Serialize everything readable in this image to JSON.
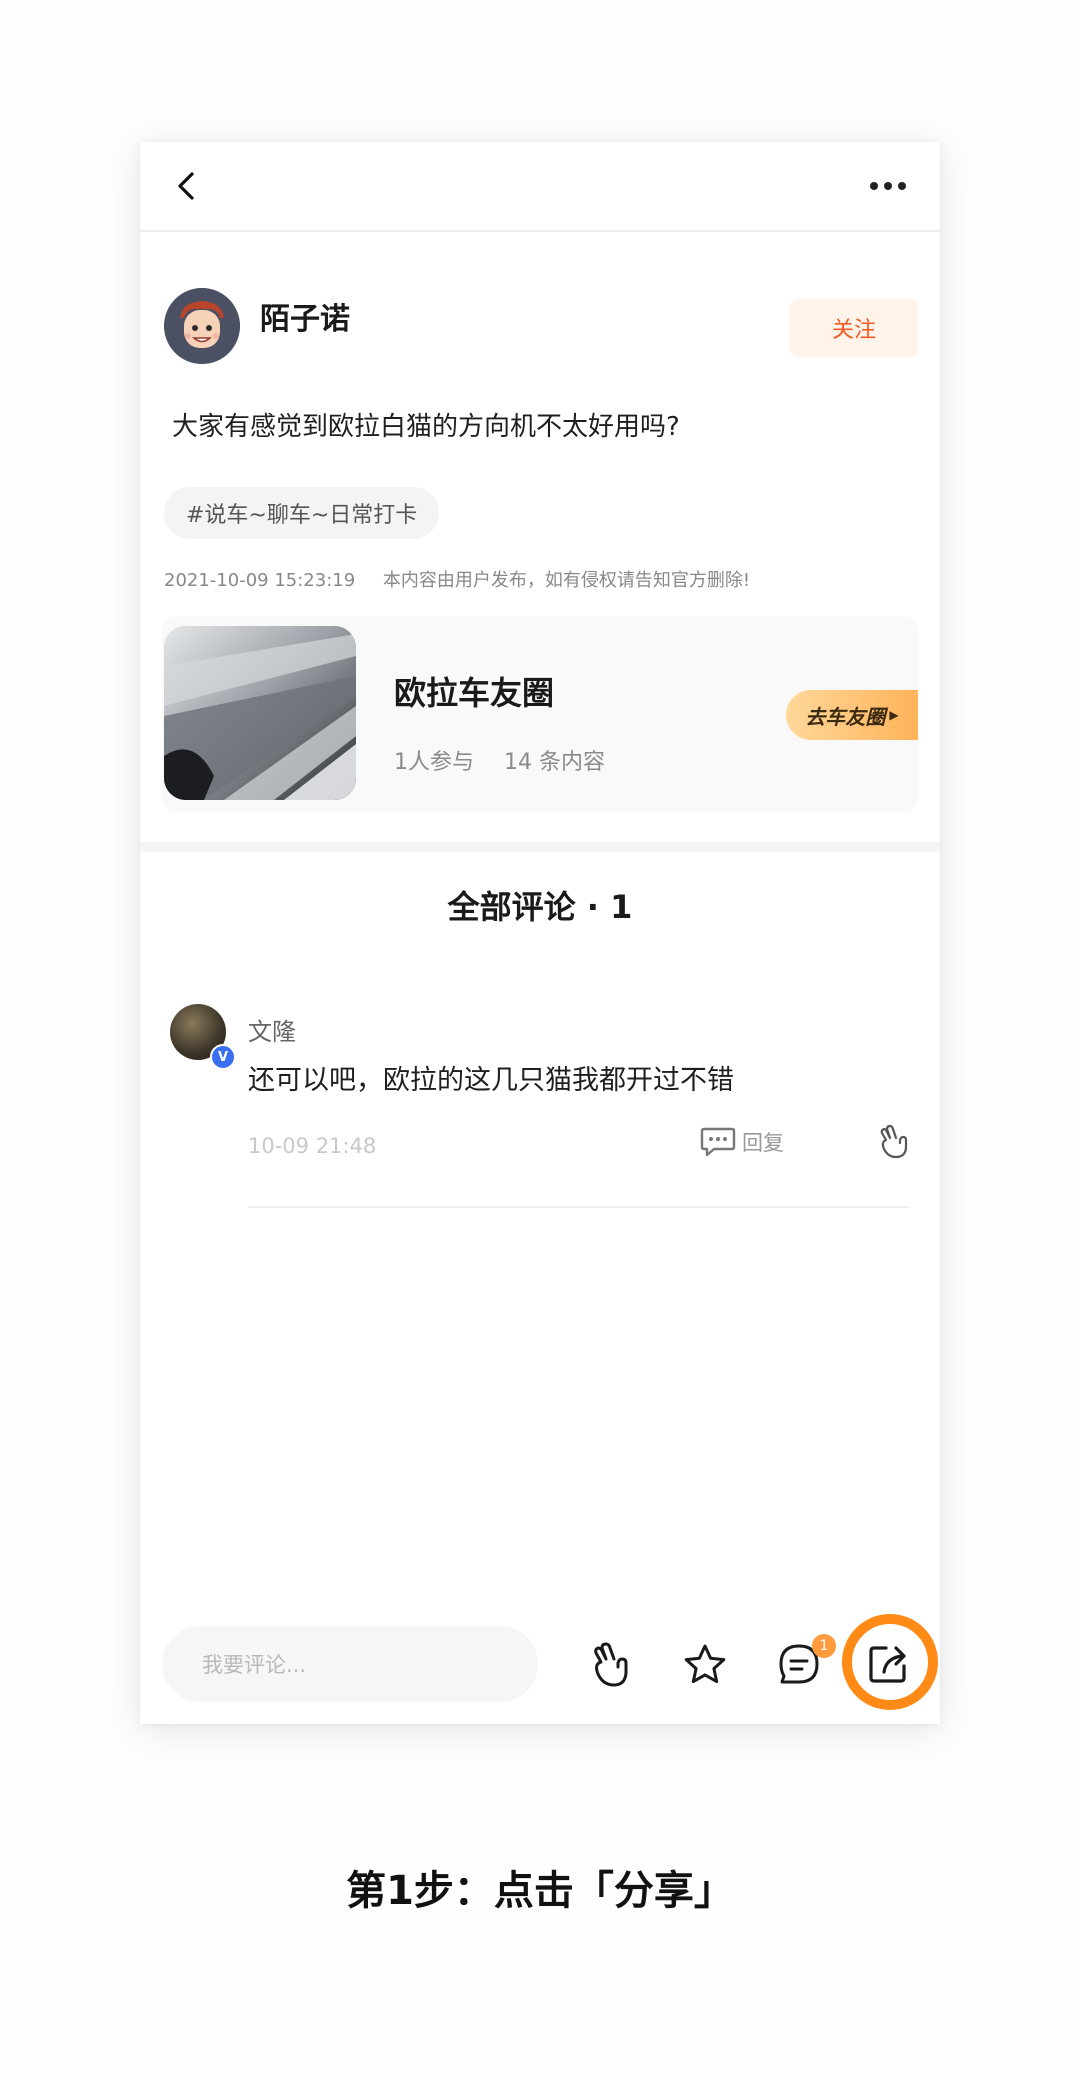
{
  "nav": {
    "back": "back",
    "more": "more"
  },
  "post": {
    "author": "陌子诺",
    "follow_label": "关注",
    "body": "大家有感觉到欧拉白猫的方向机不太好用吗?",
    "topic": "#说车~聊车~日常打卡",
    "timestamp": "2021-10-09 15:23:19",
    "disclaimer": "本内容由用户发布，如有侵权请告知官方删除!"
  },
  "circle": {
    "name": "欧拉车友圈",
    "participants": "1人参与",
    "posts": "14 条内容",
    "button_label": "去车友圈"
  },
  "comments": {
    "title": "全部评论 · 1",
    "items": [
      {
        "user": "文隆",
        "badge": "V",
        "text": "还可以吧，欧拉的这几只猫我都开过不错",
        "time": "10-09 21:48",
        "reply_label": "回复"
      }
    ]
  },
  "bottom_bar": {
    "input_placeholder": "我要评论...",
    "comment_count": "1",
    "icons": [
      "like-icon",
      "star-icon",
      "comment-icon",
      "share-icon"
    ],
    "highlight_color": "#ff8a15"
  },
  "caption": "第1步：点击「分享」",
  "colors": {
    "accent": "#f25c22",
    "follow_bg": "#fff3ea",
    "verified": "#3a6ef0"
  }
}
